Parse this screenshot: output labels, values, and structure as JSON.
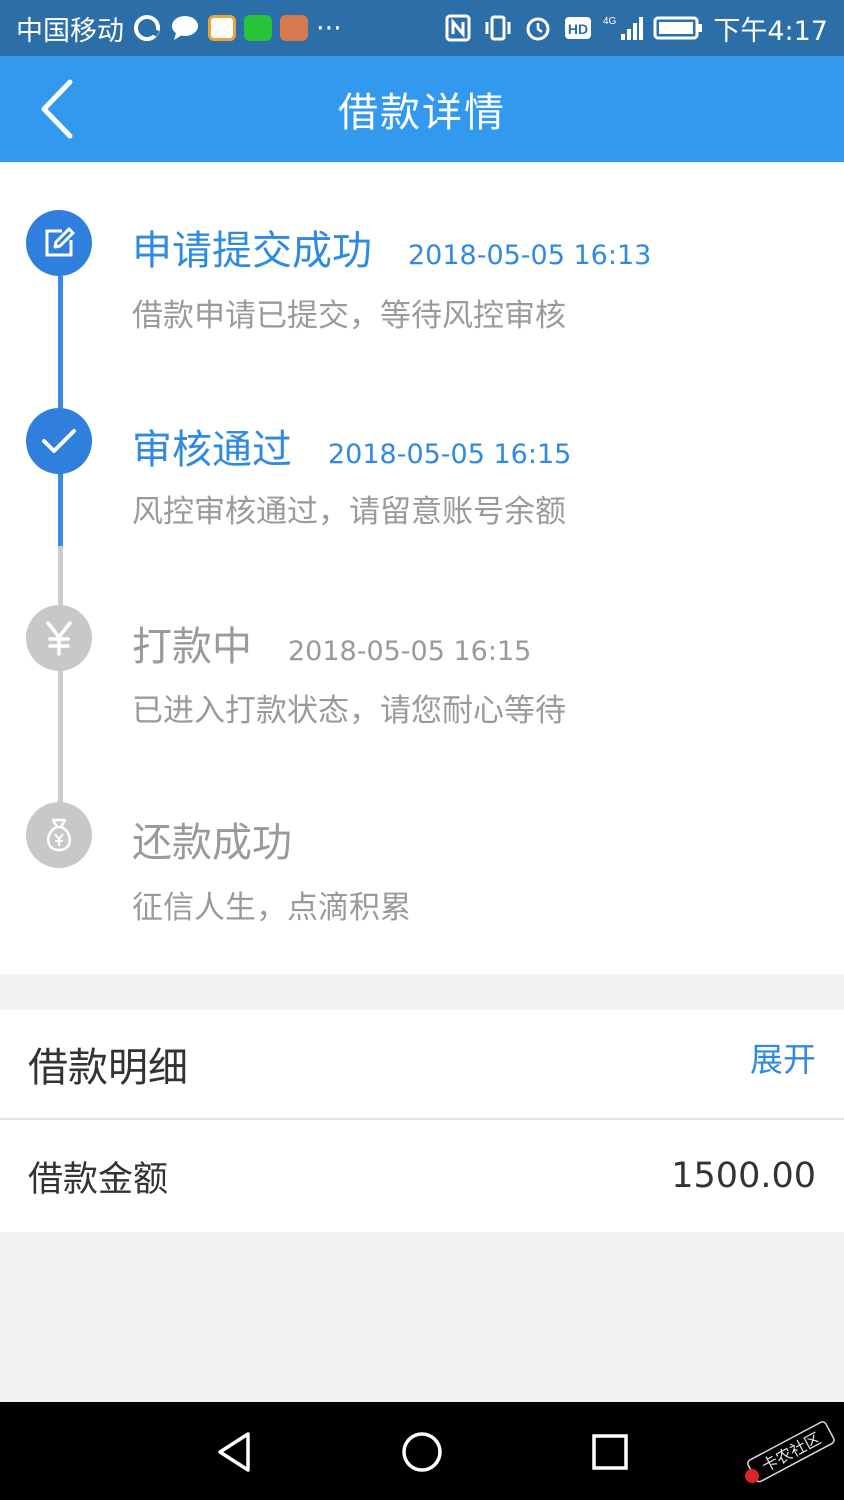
{
  "status_bar": {
    "carrier": "中国移动",
    "more": "···",
    "network": "4G",
    "time": "下午4:17"
  },
  "header": {
    "title": "借款详情"
  },
  "timeline": [
    {
      "title": "申请提交成功",
      "time": "2018-05-05 16:13",
      "desc": "借款申请已提交，等待风控审核",
      "icon": "edit-icon",
      "state": "done"
    },
    {
      "title": "审核通过",
      "time": "2018-05-05 16:15",
      "desc": "风控审核通过，请留意账号余额",
      "icon": "check-icon",
      "state": "done"
    },
    {
      "title": "打款中",
      "time": "2018-05-05 16:15",
      "desc": "已进入打款状态，请您耐心等待",
      "icon": "yen-icon",
      "state": "pending"
    },
    {
      "title": "还款成功",
      "time": "",
      "desc": "征信人生，点滴积累",
      "icon": "money-bag-icon",
      "state": "pending"
    }
  ],
  "loan_detail": {
    "title": "借款明细",
    "expand_label": "展开",
    "amount_label": "借款金额",
    "amount_value": "1500.00"
  },
  "colors": {
    "header_blue": "#3399ee",
    "active_blue": "#2f8ae2",
    "inactive_gray": "#c8c8c8"
  },
  "watermark": {
    "text": "卡农社区"
  }
}
